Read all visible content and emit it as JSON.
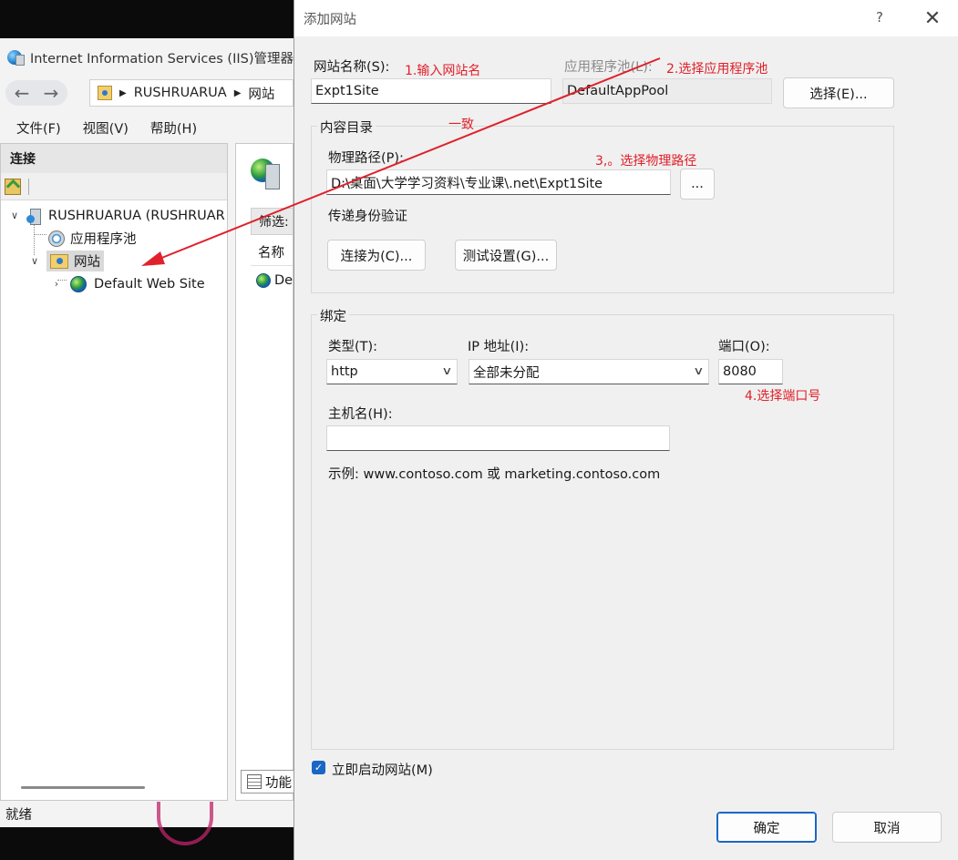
{
  "iis": {
    "title": "Internet Information Services (IIS)管理器",
    "breadcrumb": [
      "RUSHRUARUA",
      "网站"
    ],
    "menu": [
      "文件(F)",
      "视图(V)",
      "帮助(H)"
    ],
    "connections_label": "连接",
    "tree": {
      "server": "RUSHRUARUA (RUSHRUAR",
      "app_pools": "应用程序池",
      "sites": "网站",
      "default_site": "Default Web Site"
    },
    "filter_label": "筛选:",
    "name_column": "名称",
    "list_item": "De",
    "features_tab": "功能",
    "status": "就绪"
  },
  "dialog": {
    "title": "添加网站",
    "help": "?",
    "site_name_label": "网站名称(S):",
    "site_name_value": "Expt1Site",
    "app_pool_label": "应用程序池(L):",
    "app_pool_value": "DefaultAppPool",
    "select_button": "选择(E)...",
    "content_dir_label": "内容目录",
    "physical_path_label": "物理路径(P):",
    "physical_path_value": "D:\\桌面\\大学学习资料\\专业课\\.net\\Expt1Site",
    "browse_button": "...",
    "passthrough_label": "传递身份验证",
    "connect_as_button": "连接为(C)...",
    "test_settings_button": "测试设置(G)...",
    "binding_label": "绑定",
    "type_label": "类型(T):",
    "type_value": "http",
    "ip_label": "IP 地址(I):",
    "ip_value": "全部未分配",
    "port_label": "端口(O):",
    "port_value": "8080",
    "host_label": "主机名(H):",
    "host_value": "",
    "example_text": "示例: www.contoso.com 或 marketing.contoso.com",
    "start_label": "立即启动网站(M)",
    "start_checked": true,
    "ok_button": "确定",
    "cancel_button": "取消"
  },
  "annotations": {
    "note1": "1.输入网站名",
    "note2": "2.选择应用程序池",
    "note_consistent": "一致",
    "note3": "3,。选择物理路径",
    "note4": "4.选择端口号",
    "color": "#e0202a"
  }
}
